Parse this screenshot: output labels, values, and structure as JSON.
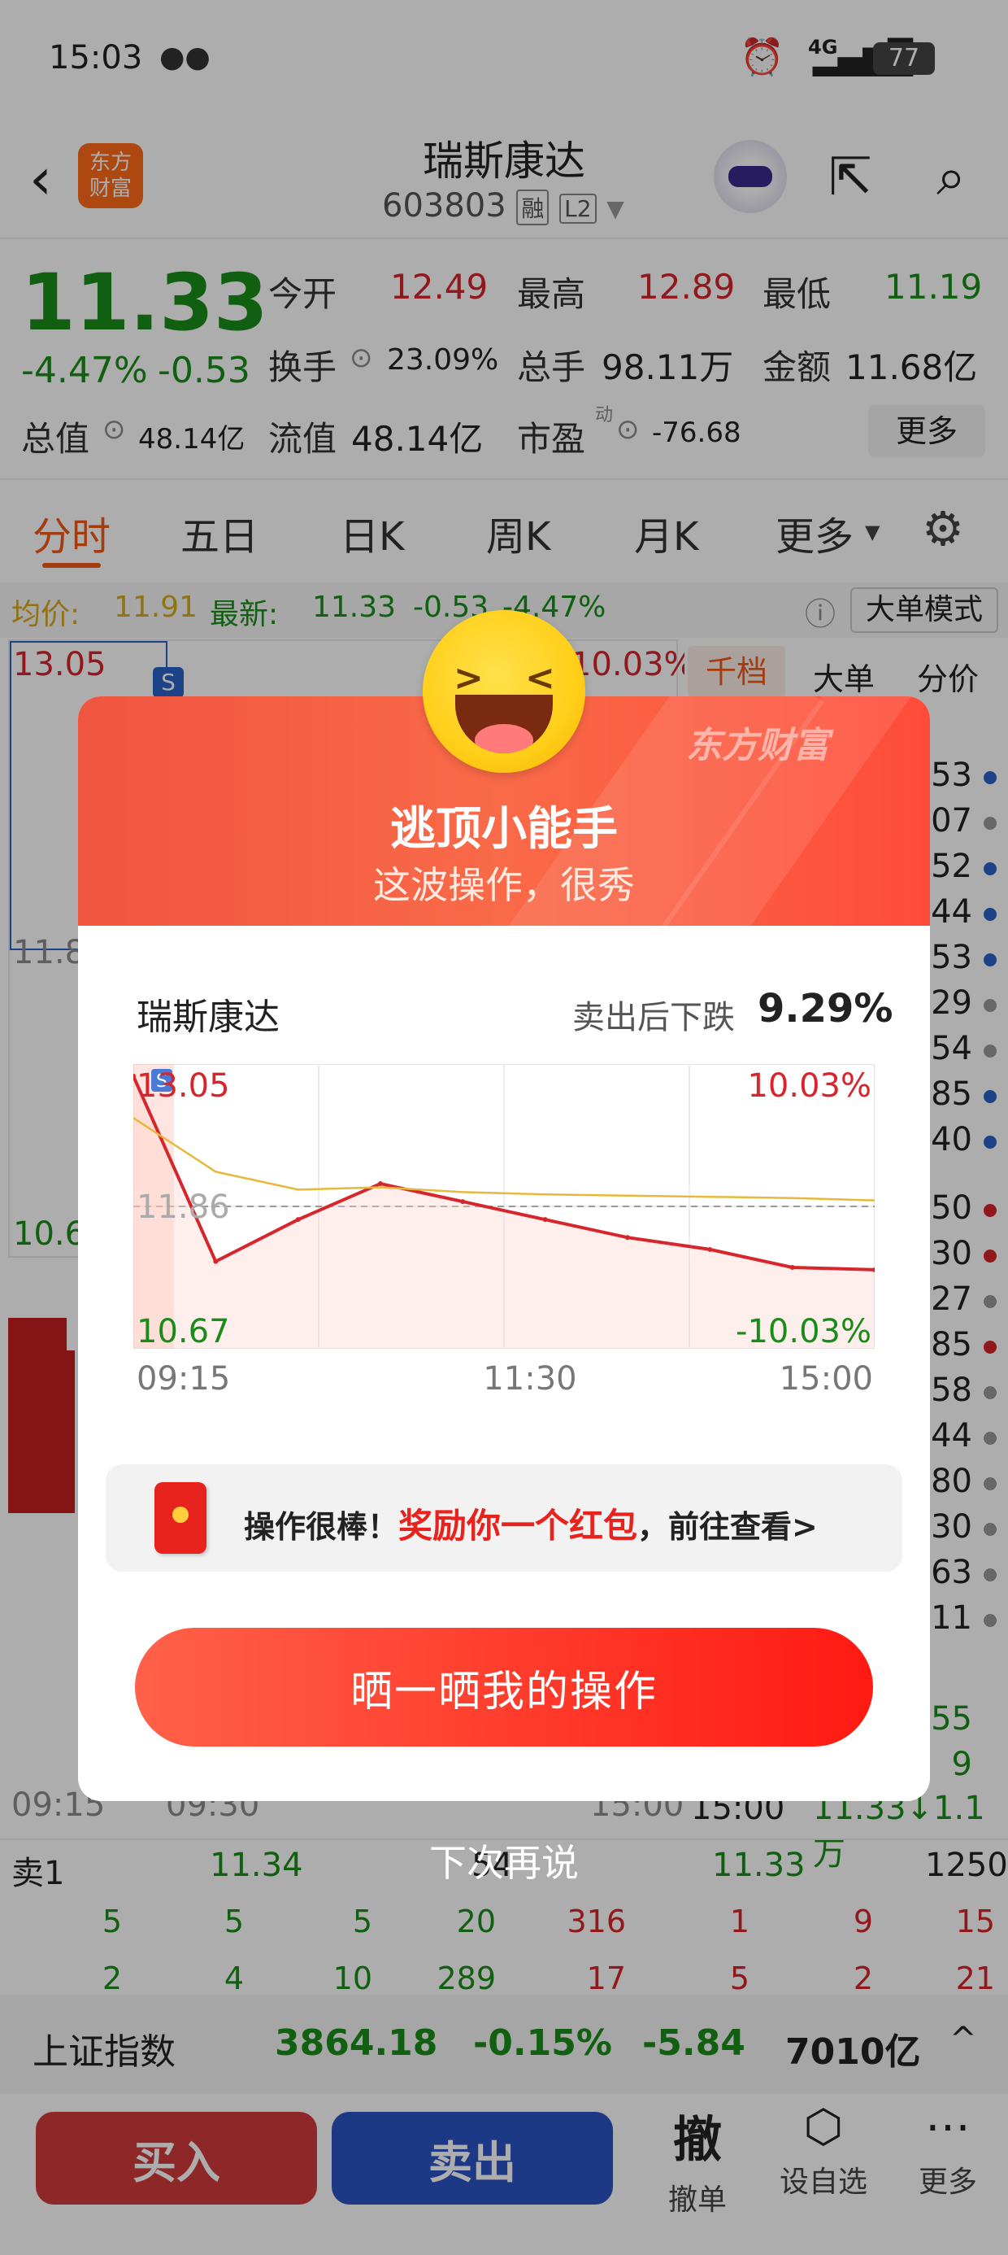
{
  "status_bar": {
    "time": "15:03",
    "network": "4G",
    "battery": "77"
  },
  "header": {
    "title": "瑞斯康达",
    "code": "603803",
    "badge_margin": "融",
    "badge_level": "L2"
  },
  "quote": {
    "price": "11.33",
    "change_pct": "-4.47%",
    "change": "-0.53",
    "open_label": "今开",
    "open": "12.49",
    "high_label": "最高",
    "high": "12.89",
    "low_label": "最低",
    "low": "11.19",
    "turnover_label": "换手",
    "turnover": "23.09%",
    "volume_label": "总手",
    "volume": "98.11万",
    "amount_label": "金额",
    "amount": "11.68亿",
    "mktcap_label": "总值",
    "mktcap": "48.14亿",
    "float_label": "流值",
    "float": "48.14亿",
    "pe_label": "市盈",
    "pe_sup": "动",
    "pe": "-76.68",
    "more": "更多"
  },
  "tabs": [
    "分时",
    "五日",
    "日K",
    "周K",
    "月K",
    "更多"
  ],
  "info_line": {
    "avg_label": "均价:",
    "avg": "11.91",
    "latest_label": "最新:",
    "latest": "11.33",
    "chg": "-0.53",
    "pct": "-4.47%",
    "mode": "大单模式"
  },
  "side_tabs": [
    "千档",
    "大单",
    "分价"
  ],
  "chart_bg": {
    "top_left": "13.05",
    "top_right": "10.03%",
    "mid_left": "11.8",
    "low_left": "10.6",
    "x_labels": [
      "09:15",
      "09:30",
      "15:00"
    ],
    "s_marker": "S"
  },
  "right_panel": {
    "values": [
      "453",
      "07",
      "552",
      "744",
      "753",
      "29",
      "54",
      "585",
      "840",
      "250",
      "430",
      "27",
      "785",
      "58",
      "44",
      "80",
      "30",
      "63",
      "11",
      "155",
      "9"
    ],
    "dot_colors": [
      "#2a62c9",
      "#999999",
      "#2a62c9",
      "#2a62c9",
      "#2a62c9",
      "#999999",
      "#999999",
      "#2a62c9",
      "#2a62c9",
      "#d6262b",
      "#d6262b",
      "#999999",
      "#d6262b",
      "#999999",
      "#999999",
      "#999999",
      "#999999",
      "#999999",
      "#999999"
    ],
    "last_time": "15:00",
    "last_trade": "11.33↓1.1万"
  },
  "order_book": {
    "sell1_label": "卖1",
    "sell1_price": "11.34",
    "mid_num": "54",
    "right_price": "11.33",
    "right_vol": "1250",
    "row1": [
      "5",
      "5",
      "5",
      "20",
      "316",
      "1",
      "9",
      "15"
    ],
    "row2": [
      "2",
      "4",
      "10",
      "289",
      "17",
      "5",
      "2",
      "21"
    ]
  },
  "index_bar": {
    "name": "上证指数",
    "value": "3864.18",
    "pct": "-0.15%",
    "chg": "-5.84",
    "amount": "7010亿"
  },
  "bottom_bar": {
    "buy": "买入",
    "sell": "卖出",
    "cancel_icon": "撤",
    "cancel": "撤单",
    "watch": "设自选",
    "more": "更多"
  },
  "modal": {
    "brand": "东方财富",
    "title": "逃顶小能手",
    "subtitle": "这波操作，很秀",
    "stock": "瑞斯康达",
    "drop_label": "卖出后下跌",
    "drop_value": "9.29%",
    "chart_top_left": "13.05",
    "chart_top_right": "10.03%",
    "chart_mid_left": "11.86",
    "chart_bottom_left": "10.67",
    "chart_bottom_right": "-10.03%",
    "x_labels": [
      "09:15",
      "11:30",
      "15:00"
    ],
    "s_marker": "S",
    "reward_prefix": "操作很棒！",
    "reward_highlight": "奖励你一个红包",
    "reward_suffix": "，前往查看>",
    "share_button": "晒一晒我的操作",
    "dismiss": "下次再说"
  },
  "chart_data": {
    "type": "line",
    "title": "",
    "x": [
      "09:15",
      "09:30",
      "10:00",
      "10:30",
      "11:00",
      "11:30",
      "13:30",
      "14:00",
      "14:30",
      "15:00"
    ],
    "series": [
      {
        "name": "",
        "color": "#d6262b",
        "values": [
          12.95,
          11.4,
          11.75,
          12.05,
          11.9,
          11.75,
          11.6,
          11.5,
          11.35,
          11.33
        ]
      },
      {
        "name": "",
        "color": "#e6b93c",
        "values": [
          12.6,
          12.15,
          12.0,
          12.02,
          11.98,
          11.96,
          11.95,
          11.94,
          11.93,
          11.91
        ]
      }
    ],
    "ylim": [
      10.67,
      13.05
    ],
    "reference": 11.86,
    "grid": true
  }
}
